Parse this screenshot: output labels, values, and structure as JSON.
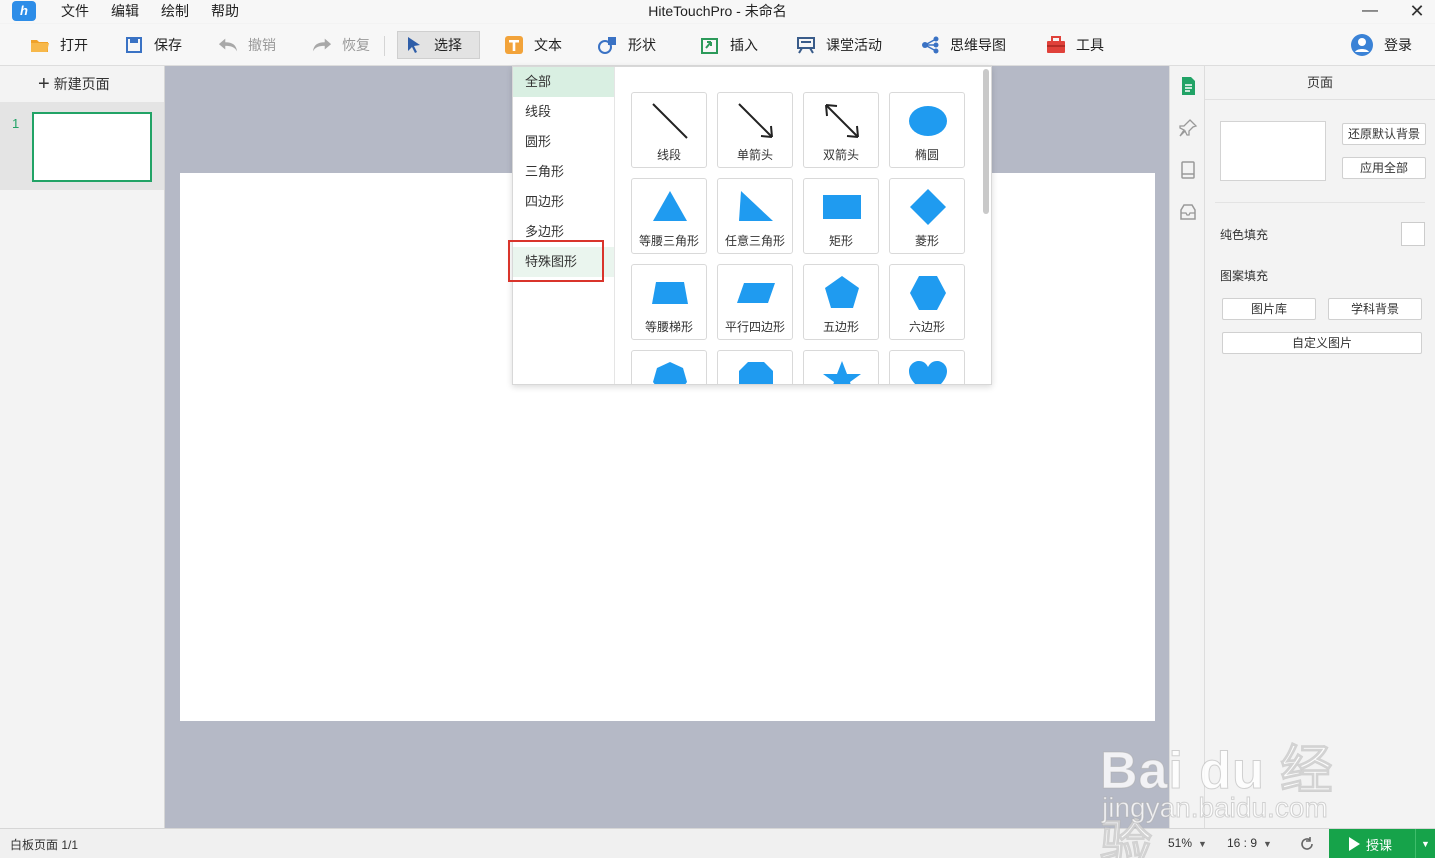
{
  "window": {
    "title": "HiteTouchPro - 未命名",
    "logo_text": "h",
    "minimize": "—",
    "close": "✕"
  },
  "menu": [
    "文件",
    "编辑",
    "绘制",
    "帮助"
  ],
  "toolbar": {
    "open": "打开",
    "save": "保存",
    "undo": "撤销",
    "redo": "恢复",
    "select": "选择",
    "text": "文本",
    "shape": "形状",
    "insert": "插入",
    "class_activity": "课堂活动",
    "mindmap": "思维导图",
    "tools": "工具",
    "login": "登录"
  },
  "left_panel": {
    "new_page": "新建页面",
    "plus": "+",
    "pages": [
      {
        "number": "1"
      }
    ]
  },
  "shape_popup": {
    "categories": [
      "全部",
      "线段",
      "圆形",
      "三角形",
      "四边形",
      "多边形",
      "特殊图形"
    ],
    "selected_category": "全部",
    "highlighted_category": "特殊图形",
    "shapes": [
      {
        "label": "线段",
        "icon": "line-icon"
      },
      {
        "label": "单箭头",
        "icon": "single-arrow-icon"
      },
      {
        "label": "双箭头",
        "icon": "double-arrow-icon"
      },
      {
        "label": "椭圆",
        "icon": "ellipse-icon"
      },
      {
        "label": "等腰三角形",
        "icon": "isosceles-triangle-icon"
      },
      {
        "label": "任意三角形",
        "icon": "arbitrary-triangle-icon"
      },
      {
        "label": "矩形",
        "icon": "rectangle-icon"
      },
      {
        "label": "菱形",
        "icon": "rhombus-icon"
      },
      {
        "label": "等腰梯形",
        "icon": "trapezoid-icon"
      },
      {
        "label": "平行四边形",
        "icon": "parallelogram-icon"
      },
      {
        "label": "五边形",
        "icon": "pentagon-icon"
      },
      {
        "label": "六边形",
        "icon": "hexagon-icon"
      },
      {
        "label": "",
        "icon": "heptagon-icon"
      },
      {
        "label": "",
        "icon": "octagon-icon"
      },
      {
        "label": "",
        "icon": "star-icon"
      },
      {
        "label": "",
        "icon": "heart-icon"
      }
    ],
    "shape_color": "#1f9bf0"
  },
  "properties": {
    "title": "页面",
    "restore_bg": "还原默认背景",
    "apply_all": "应用全部",
    "solid_fill": "纯色填充",
    "pattern_fill": "图案填充",
    "image_library": "图片库",
    "subject_bg": "学科背景",
    "custom_image": "自定义图片"
  },
  "status": {
    "page_info": "白板页面 1/1",
    "zoom": "51%",
    "ratio": "16 : 9",
    "start_class": "授课"
  },
  "watermark": {
    "brand": "Bai du 经验",
    "url": "jingyan.baidu.com"
  },
  "colors": {
    "accent_green": "#21a366",
    "shape_blue": "#1f9bf0",
    "highlight_red": "#d9342b"
  }
}
